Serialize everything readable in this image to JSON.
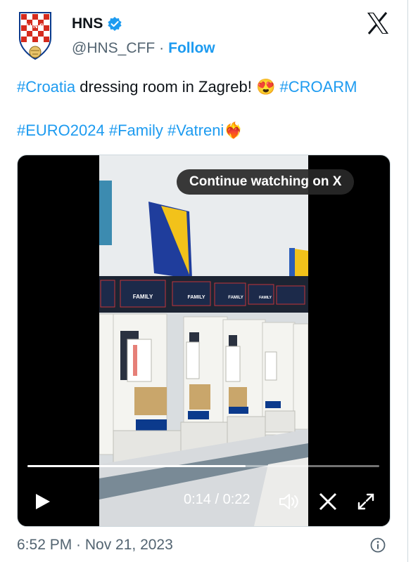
{
  "account": {
    "name": "HNS",
    "handle": "@HNS_CFF",
    "separator": "·",
    "follow_label": "Follow",
    "logo_text": "HNS"
  },
  "tweet": {
    "line1": [
      {
        "text": "#Croatia",
        "type": "tag"
      },
      {
        "text": " dressing room in Zagreb! ",
        "type": "text"
      },
      {
        "text": "😍",
        "type": "emoji"
      },
      {
        "text": " #CROARM",
        "type": "tag"
      }
    ],
    "line2": [
      {
        "text": "#EURO2024",
        "type": "tag"
      },
      {
        "text": " ",
        "type": "text"
      },
      {
        "text": "#Family",
        "type": "tag"
      },
      {
        "text": " ",
        "type": "text"
      },
      {
        "text": "#Vatreni",
        "type": "tag"
      },
      {
        "text": "❤️‍🔥",
        "type": "emoji"
      }
    ]
  },
  "video": {
    "continue_label": "Continue watching on X",
    "time_label": "0:14 / 0:22",
    "progress": 0.62,
    "banner_text": "FAMILY"
  },
  "footer": {
    "timestamp": "6:52 PM · Nov 21, 2023"
  },
  "colors": {
    "accent": "#1d9bf0",
    "text": "#0f1419",
    "muted": "#536471",
    "croatia_red": "#d52b1e",
    "croatia_blue": "#0b3a8c"
  },
  "icons": [
    "verified-badge-icon",
    "x-logo-icon",
    "play-icon",
    "volume-icon",
    "x-small-icon",
    "fullscreen-icon",
    "info-icon"
  ]
}
